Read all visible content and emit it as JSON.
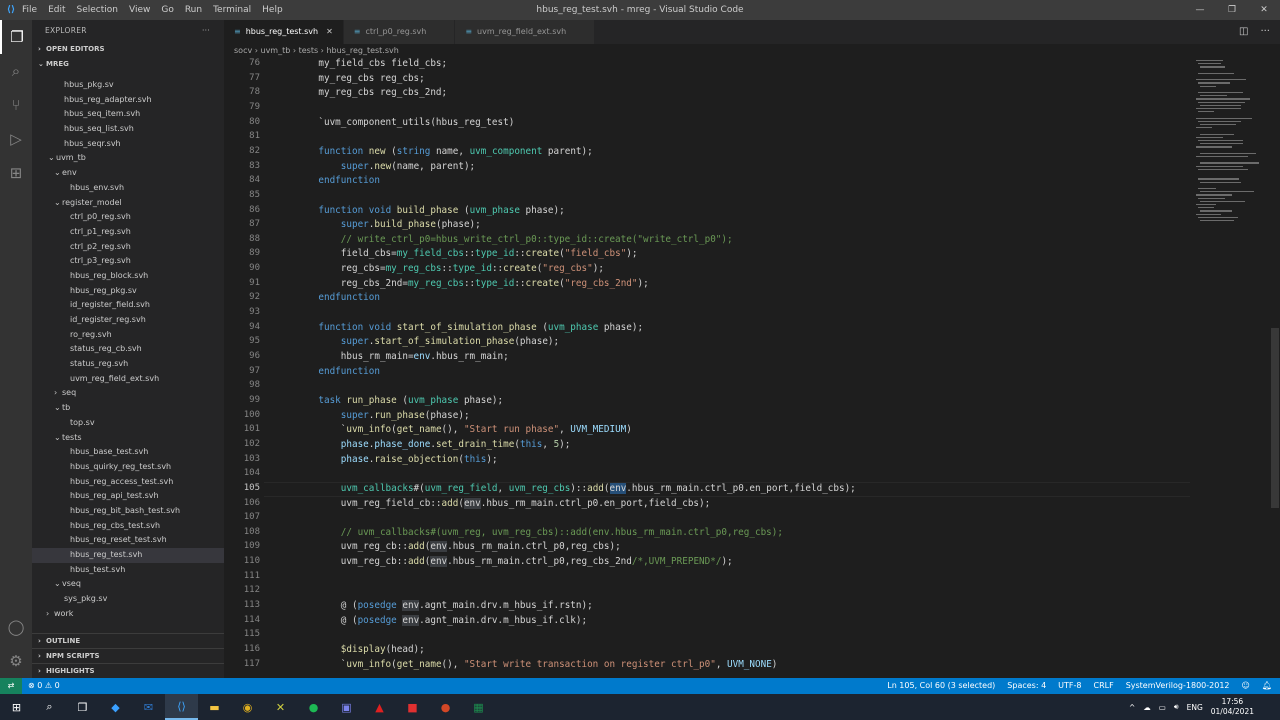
{
  "window": {
    "title": "hbus_reg_test.svh - mreg - Visual Studio Code",
    "menu": [
      "File",
      "Edit",
      "Selection",
      "View",
      "Go",
      "Run",
      "Terminal",
      "Help"
    ]
  },
  "sidebar": {
    "title": "EXPLORER",
    "open_editors": "OPEN EDITORS",
    "workspace": "MREG",
    "tree": [
      {
        "label": "hbus_pkg.sv",
        "indent": 32,
        "type": "file"
      },
      {
        "label": "hbus_reg_adapter.svh",
        "indent": 32,
        "type": "file"
      },
      {
        "label": "hbus_seq_item.svh",
        "indent": 32,
        "type": "file"
      },
      {
        "label": "hbus_seq_list.svh",
        "indent": 32,
        "type": "file"
      },
      {
        "label": "hbus_seqr.svh",
        "indent": 32,
        "type": "file"
      },
      {
        "label": "uvm_tb",
        "indent": 16,
        "type": "open"
      },
      {
        "label": "env",
        "indent": 22,
        "type": "open"
      },
      {
        "label": "hbus_env.svh",
        "indent": 38,
        "type": "file"
      },
      {
        "label": "register_model",
        "indent": 22,
        "type": "open"
      },
      {
        "label": "ctrl_p0_reg.svh",
        "indent": 38,
        "type": "file"
      },
      {
        "label": "ctrl_p1_reg.svh",
        "indent": 38,
        "type": "file"
      },
      {
        "label": "ctrl_p2_reg.svh",
        "indent": 38,
        "type": "file"
      },
      {
        "label": "ctrl_p3_reg.svh",
        "indent": 38,
        "type": "file"
      },
      {
        "label": "hbus_reg_block.svh",
        "indent": 38,
        "type": "file"
      },
      {
        "label": "hbus_reg_pkg.sv",
        "indent": 38,
        "type": "file"
      },
      {
        "label": "id_register_field.svh",
        "indent": 38,
        "type": "file"
      },
      {
        "label": "id_register_reg.svh",
        "indent": 38,
        "type": "file"
      },
      {
        "label": "ro_reg.svh",
        "indent": 38,
        "type": "file"
      },
      {
        "label": "status_reg_cb.svh",
        "indent": 38,
        "type": "file"
      },
      {
        "label": "status_reg.svh",
        "indent": 38,
        "type": "file"
      },
      {
        "label": "uvm_reg_field_ext.svh",
        "indent": 38,
        "type": "file"
      },
      {
        "label": "seq",
        "indent": 22,
        "type": "closed"
      },
      {
        "label": "tb",
        "indent": 22,
        "type": "open"
      },
      {
        "label": "top.sv",
        "indent": 38,
        "type": "file"
      },
      {
        "label": "tests",
        "indent": 22,
        "type": "open"
      },
      {
        "label": "hbus_base_test.svh",
        "indent": 38,
        "type": "file"
      },
      {
        "label": "hbus_quirky_reg_test.svh",
        "indent": 38,
        "type": "file"
      },
      {
        "label": "hbus_reg_access_test.svh",
        "indent": 38,
        "type": "file"
      },
      {
        "label": "hbus_reg_api_test.svh",
        "indent": 38,
        "type": "file"
      },
      {
        "label": "hbus_reg_bit_bash_test.svh",
        "indent": 38,
        "type": "file"
      },
      {
        "label": "hbus_reg_cbs_test.svh",
        "indent": 38,
        "type": "file"
      },
      {
        "label": "hbus_reg_reset_test.svh",
        "indent": 38,
        "type": "file"
      },
      {
        "label": "hbus_reg_test.svh",
        "indent": 38,
        "type": "file",
        "selected": true
      },
      {
        "label": "hbus_test.svh",
        "indent": 38,
        "type": "file"
      },
      {
        "label": "vseq",
        "indent": 22,
        "type": "open"
      },
      {
        "label": "sys_pkg.sv",
        "indent": 32,
        "type": "file"
      },
      {
        "label": "work",
        "indent": 14,
        "type": "closed"
      }
    ],
    "bottom_sections": [
      "OUTLINE",
      "NPM SCRIPTS",
      "HIGHLIGHTS"
    ]
  },
  "tabs": [
    {
      "label": "hbus_reg_test.svh",
      "active": true
    },
    {
      "label": "ctrl_p0_reg.svh",
      "active": false
    },
    {
      "label": "uvm_reg_field_ext.svh",
      "active": false
    }
  ],
  "breadcrumb": [
    "socv",
    "uvm_tb",
    "tests",
    "hbus_reg_test.svh"
  ],
  "editor": {
    "current_line": 105,
    "lines": [
      {
        "n": "76",
        "t": [
          [
            "    my_field_cbs field_cbs;",
            ""
          ]
        ]
      },
      {
        "n": "77",
        "t": [
          [
            "    my_reg_cbs reg_cbs;",
            ""
          ]
        ]
      },
      {
        "n": "78",
        "t": [
          [
            "    my_reg_cbs reg_cbs_2nd;",
            ""
          ]
        ]
      },
      {
        "n": "79",
        "t": []
      },
      {
        "n": "80",
        "t": [
          [
            "    `uvm_component_utils(hbus_reg_test)",
            ""
          ]
        ]
      },
      {
        "n": "81",
        "t": []
      },
      {
        "n": "82",
        "t": [
          [
            "    ",
            ""
          ],
          [
            "function",
            "kw"
          ],
          [
            " ",
            ""
          ],
          [
            "new",
            "fn"
          ],
          [
            " (",
            ""
          ],
          [
            "string",
            "kw"
          ],
          [
            " name, ",
            ""
          ],
          [
            "uvm_component",
            "ty"
          ],
          [
            " parent);",
            ""
          ]
        ]
      },
      {
        "n": "83",
        "t": [
          [
            "        ",
            ""
          ],
          [
            "super",
            "kw"
          ],
          [
            ".",
            ""
          ],
          [
            "new",
            "fn"
          ],
          [
            "(name, parent);",
            ""
          ]
        ]
      },
      {
        "n": "84",
        "t": [
          [
            "    ",
            ""
          ],
          [
            "endfunction",
            "kw"
          ]
        ]
      },
      {
        "n": "85",
        "t": []
      },
      {
        "n": "86",
        "t": [
          [
            "    ",
            ""
          ],
          [
            "function",
            "kw"
          ],
          [
            " ",
            ""
          ],
          [
            "void",
            "kw"
          ],
          [
            " ",
            ""
          ],
          [
            "build_phase",
            "fn"
          ],
          [
            " (",
            ""
          ],
          [
            "uvm_phase",
            "ty"
          ],
          [
            " phase);",
            ""
          ]
        ]
      },
      {
        "n": "87",
        "t": [
          [
            "        ",
            ""
          ],
          [
            "super",
            "kw"
          ],
          [
            ".",
            ""
          ],
          [
            "build_phase",
            "fn"
          ],
          [
            "(phase);",
            ""
          ]
        ]
      },
      {
        "n": "88",
        "t": [
          [
            "        // write_ctrl_p0=hbus_write_ctrl_p0::type_id::create(\"write_ctrl_p0\");",
            "cm"
          ]
        ]
      },
      {
        "n": "89",
        "t": [
          [
            "        field_cbs=",
            ""
          ],
          [
            "my_field_cbs",
            "ty"
          ],
          [
            "::",
            ""
          ],
          [
            "type_id",
            "ty"
          ],
          [
            "::",
            ""
          ],
          [
            "create",
            "fn"
          ],
          [
            "(",
            ""
          ],
          [
            "\"field_cbs\"",
            "str"
          ],
          [
            ");",
            ""
          ]
        ]
      },
      {
        "n": "90",
        "t": [
          [
            "        reg_cbs=",
            ""
          ],
          [
            "my_reg_cbs",
            "ty"
          ],
          [
            "::",
            ""
          ],
          [
            "type_id",
            "ty"
          ],
          [
            "::",
            ""
          ],
          [
            "create",
            "fn"
          ],
          [
            "(",
            ""
          ],
          [
            "\"reg_cbs\"",
            "str"
          ],
          [
            ");",
            ""
          ]
        ]
      },
      {
        "n": "91",
        "t": [
          [
            "        reg_cbs_2nd=",
            ""
          ],
          [
            "my_reg_cbs",
            "ty"
          ],
          [
            "::",
            ""
          ],
          [
            "type_id",
            "ty"
          ],
          [
            "::",
            ""
          ],
          [
            "create",
            "fn"
          ],
          [
            "(",
            ""
          ],
          [
            "\"reg_cbs_2nd\"",
            "str"
          ],
          [
            ");",
            ""
          ]
        ]
      },
      {
        "n": "92",
        "t": [
          [
            "    ",
            ""
          ],
          [
            "endfunction",
            "kw"
          ]
        ]
      },
      {
        "n": "93",
        "t": []
      },
      {
        "n": "94",
        "t": [
          [
            "    ",
            ""
          ],
          [
            "function",
            "kw"
          ],
          [
            " ",
            ""
          ],
          [
            "void",
            "kw"
          ],
          [
            " ",
            ""
          ],
          [
            "start_of_simulation_phase",
            "fn"
          ],
          [
            " (",
            ""
          ],
          [
            "uvm_phase",
            "ty"
          ],
          [
            " phase);",
            ""
          ]
        ]
      },
      {
        "n": "95",
        "t": [
          [
            "        ",
            ""
          ],
          [
            "super",
            "kw"
          ],
          [
            ".",
            ""
          ],
          [
            "start_of_simulation_phase",
            "fn"
          ],
          [
            "(phase);",
            ""
          ]
        ]
      },
      {
        "n": "96",
        "t": [
          [
            "        hbus_rm_main=",
            ""
          ],
          [
            "env",
            "vr"
          ],
          [
            ".hbus_rm_main;",
            ""
          ]
        ]
      },
      {
        "n": "97",
        "t": [
          [
            "    ",
            ""
          ],
          [
            "endfunction",
            "kw"
          ]
        ]
      },
      {
        "n": "98",
        "t": []
      },
      {
        "n": "99",
        "t": [
          [
            "    ",
            ""
          ],
          [
            "task",
            "kw"
          ],
          [
            " ",
            ""
          ],
          [
            "run_phase",
            "fn"
          ],
          [
            " (",
            ""
          ],
          [
            "uvm_phase",
            "ty"
          ],
          [
            " phase);",
            ""
          ]
        ]
      },
      {
        "n": "100",
        "t": [
          [
            "        ",
            ""
          ],
          [
            "super",
            "kw"
          ],
          [
            ".",
            ""
          ],
          [
            "run_phase",
            "fn"
          ],
          [
            "(phase);",
            ""
          ]
        ]
      },
      {
        "n": "101",
        "t": [
          [
            "        `",
            ""
          ],
          [
            "uvm_info",
            "fn"
          ],
          [
            "(",
            ""
          ],
          [
            "get_name",
            "fn"
          ],
          [
            "(), ",
            ""
          ],
          [
            "\"Start run phase\"",
            "str"
          ],
          [
            ", ",
            ""
          ],
          [
            "UVM_MEDIUM",
            "vr"
          ],
          [
            ")",
            ""
          ]
        ]
      },
      {
        "n": "102",
        "t": [
          [
            "        ",
            ""
          ],
          [
            "phase",
            "vr"
          ],
          [
            ".",
            ""
          ],
          [
            "phase_done",
            "vr"
          ],
          [
            ".",
            ""
          ],
          [
            "set_drain_time",
            "fn"
          ],
          [
            "(",
            ""
          ],
          [
            "this",
            "kw"
          ],
          [
            ", ",
            ""
          ],
          [
            "5",
            "num"
          ],
          [
            ");",
            ""
          ]
        ]
      },
      {
        "n": "103",
        "t": [
          [
            "        ",
            ""
          ],
          [
            "phase",
            "vr"
          ],
          [
            ".",
            ""
          ],
          [
            "raise_objection",
            "fn"
          ],
          [
            "(",
            ""
          ],
          [
            "this",
            "kw"
          ],
          [
            ");",
            ""
          ]
        ]
      },
      {
        "n": "104",
        "t": []
      },
      {
        "n": "105",
        "t": [
          [
            "        ",
            ""
          ],
          [
            "uvm_callbacks",
            "ty"
          ],
          [
            "#(",
            ""
          ],
          [
            "uvm_reg_field",
            "ty"
          ],
          [
            ", ",
            ""
          ],
          [
            "uvm_reg_cbs",
            "ty"
          ],
          [
            ")::",
            ""
          ],
          [
            "add",
            "fn"
          ],
          [
            "(",
            ""
          ],
          [
            "env",
            "hl"
          ],
          [
            ".hbus_rm_main.ctrl_p0.en_port,field_cbs);",
            ""
          ]
        ]
      },
      {
        "n": "106",
        "t": [
          [
            "        uvm_reg_field_cb::",
            ""
          ],
          [
            "add",
            "fn"
          ],
          [
            "(",
            ""
          ],
          [
            "env",
            "hl2"
          ],
          [
            ".hbus_rm_main.ctrl_p0.en_port,field_cbs);",
            ""
          ]
        ]
      },
      {
        "n": "107",
        "t": []
      },
      {
        "n": "108",
        "t": [
          [
            "        // uvm_callbacks#(uvm_reg, uvm_reg_cbs)::add(env.hbus_rm_main.ctrl_p0,reg_cbs);",
            "cm"
          ]
        ]
      },
      {
        "n": "109",
        "t": [
          [
            "        uvm_reg_cb::",
            ""
          ],
          [
            "add",
            "fn"
          ],
          [
            "(",
            ""
          ],
          [
            "env",
            "hl2"
          ],
          [
            ".hbus_rm_main.ctrl_p0,reg_cbs);",
            ""
          ]
        ]
      },
      {
        "n": "110",
        "t": [
          [
            "        uvm_reg_cb::",
            ""
          ],
          [
            "add",
            "fn"
          ],
          [
            "(",
            ""
          ],
          [
            "env",
            "hl2"
          ],
          [
            ".hbus_rm_main.ctrl_p0,reg_cbs_2nd",
            ""
          ],
          [
            "/*,UVM_PREPEND*/",
            "cm"
          ],
          [
            ");",
            ""
          ]
        ]
      },
      {
        "n": "111",
        "t": []
      },
      {
        "n": "112",
        "t": []
      },
      {
        "n": "113",
        "t": [
          [
            "        @ (",
            ""
          ],
          [
            "posedge",
            "kw"
          ],
          [
            " ",
            ""
          ],
          [
            "env",
            "hl2"
          ],
          [
            ".agnt_main.drv.m_hbus_if.rstn);",
            ""
          ]
        ]
      },
      {
        "n": "114",
        "t": [
          [
            "        @ (",
            ""
          ],
          [
            "posedge",
            "kw"
          ],
          [
            " ",
            ""
          ],
          [
            "env",
            "hl2"
          ],
          [
            ".agnt_main.drv.m_hbus_if.clk);",
            ""
          ]
        ]
      },
      {
        "n": "115",
        "t": []
      },
      {
        "n": "116",
        "t": [
          [
            "        ",
            ""
          ],
          [
            "$display",
            "fn"
          ],
          [
            "(head);",
            ""
          ]
        ]
      },
      {
        "n": "117",
        "t": [
          [
            "        `",
            ""
          ],
          [
            "uvm_info",
            "fn"
          ],
          [
            "(",
            ""
          ],
          [
            "get_name",
            "fn"
          ],
          [
            "(), ",
            ""
          ],
          [
            "\"Start write transaction on register ctrl_p0\"",
            "str"
          ],
          [
            ", ",
            ""
          ],
          [
            "UVM_NONE",
            "vr"
          ],
          [
            ")",
            ""
          ]
        ]
      }
    ]
  },
  "statusbar": {
    "errors": "⊗ 0 ⚠ 0",
    "position": "Ln 105, Col 60 (3 selected)",
    "spaces": "Spaces: 4",
    "encoding": "UTF-8",
    "eol": "CRLF",
    "language": "SystemVerilog-1800-2012"
  },
  "taskbar": {
    "time": "17:56",
    "date": "01/04/2021",
    "lang": "ENG"
  },
  "colors": {
    "accent": "#007acc",
    "activity": "#333333",
    "sidebar": "#252526",
    "editor": "#1e1e1e"
  }
}
